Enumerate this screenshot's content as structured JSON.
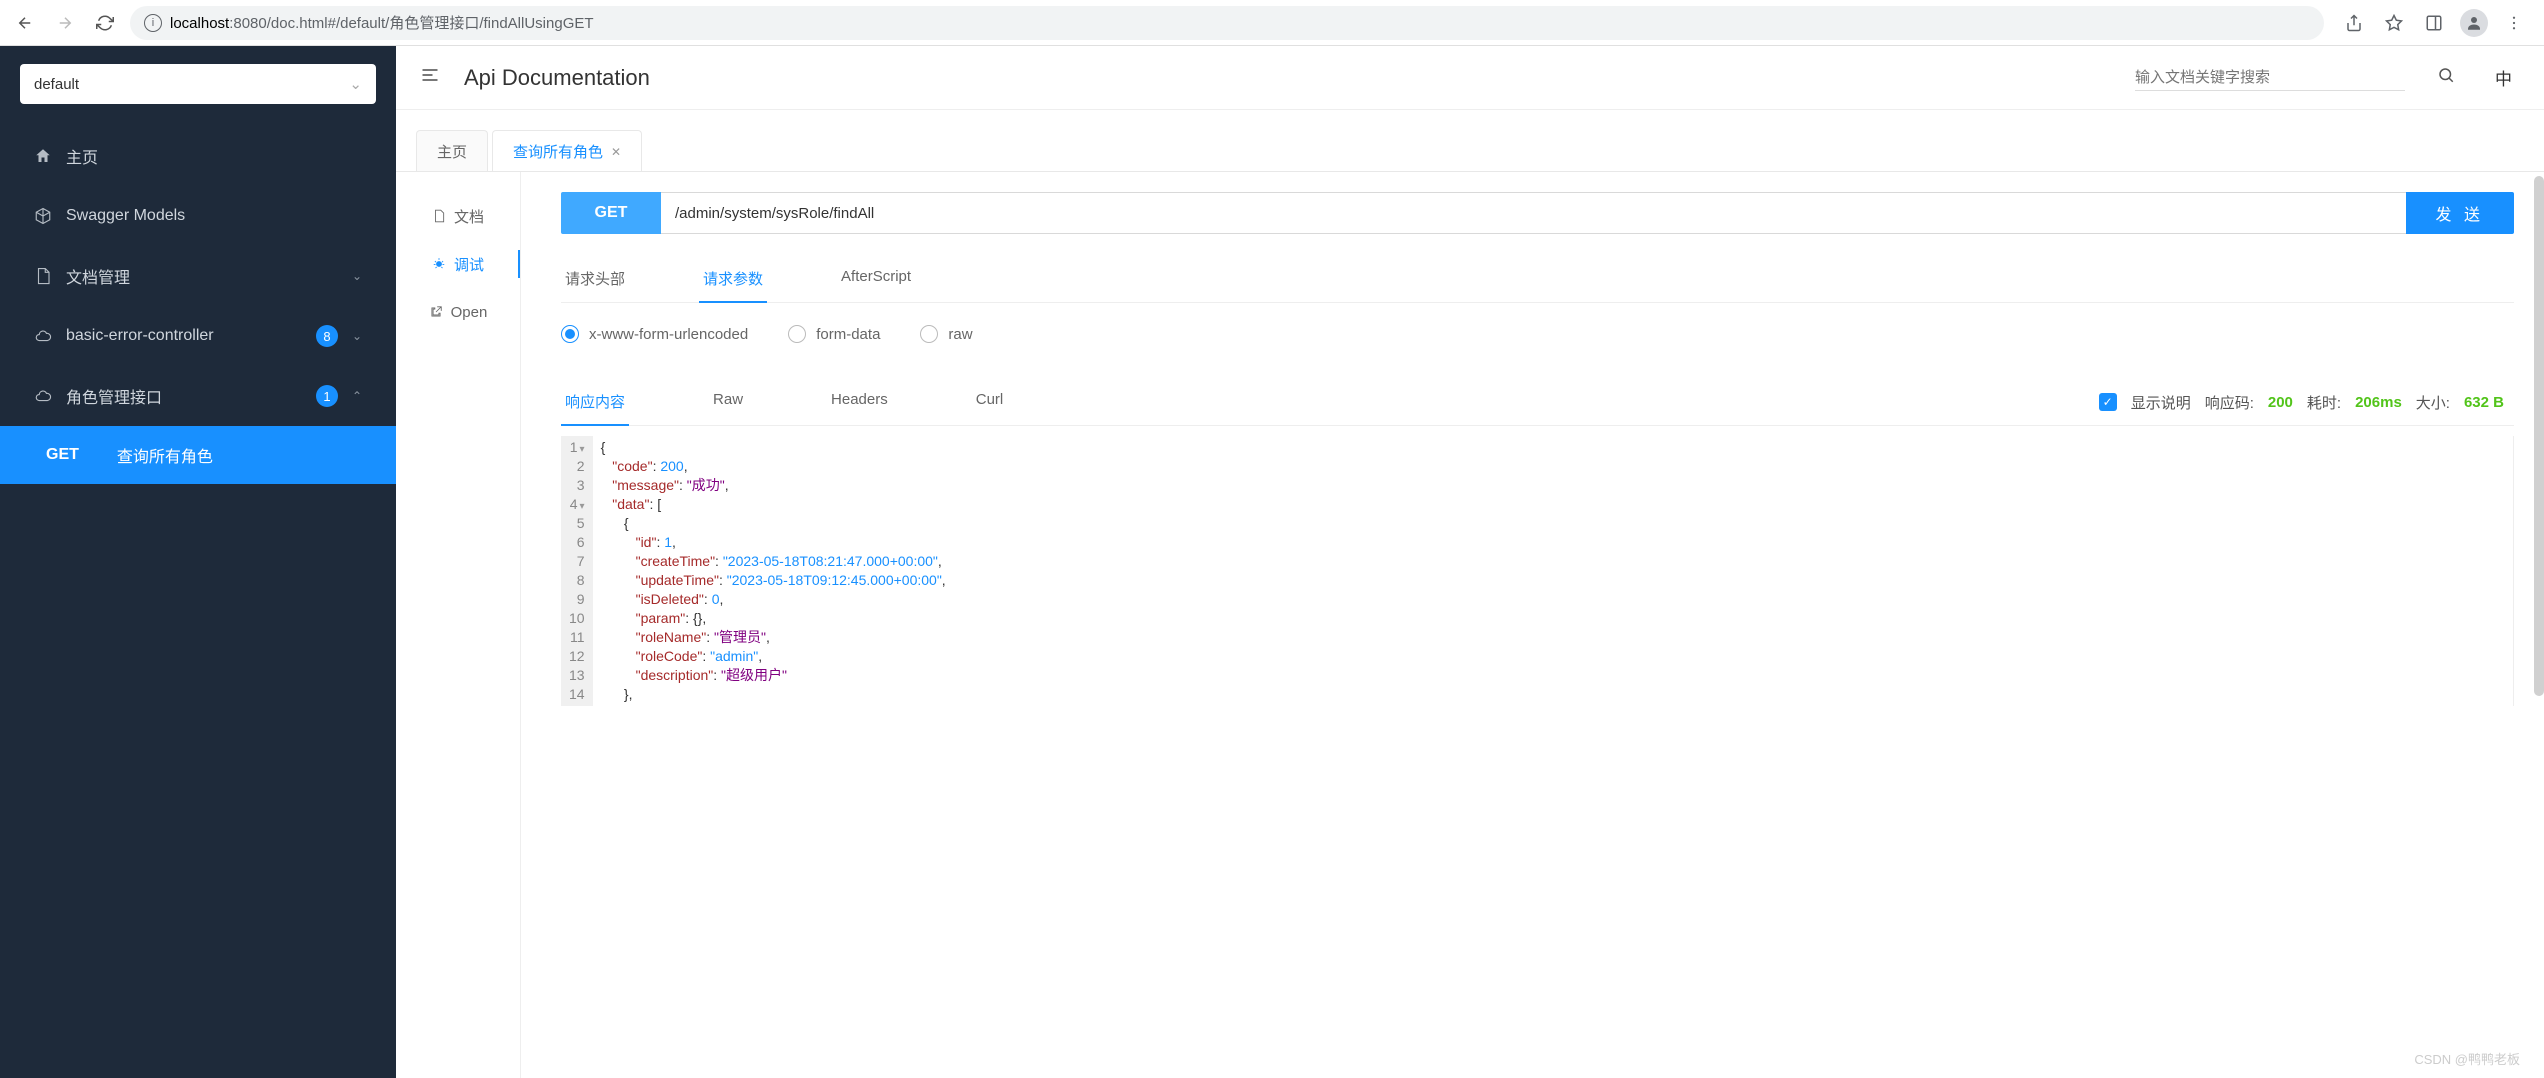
{
  "browser": {
    "url_host": "localhost",
    "url_port": ":8080",
    "url_path": "/doc.html#/default/角色管理接口/findAllUsingGET"
  },
  "sidebar": {
    "select_value": "default",
    "items": [
      {
        "icon": "home",
        "label": "主页"
      },
      {
        "icon": "cube",
        "label": "Swagger Models"
      },
      {
        "icon": "doc",
        "label": "文档管理",
        "chevron": "down"
      },
      {
        "icon": "cloud",
        "label": "basic-error-controller",
        "badge": "8",
        "chevron": "down"
      },
      {
        "icon": "cloud",
        "label": "角色管理接口",
        "badge": "1",
        "chevron": "up"
      }
    ],
    "sub": {
      "method": "GET",
      "label": "查询所有角色"
    }
  },
  "header": {
    "title": "Api Documentation",
    "search_placeholder": "输入文档关键字搜索",
    "lang": "中"
  },
  "tabs": [
    {
      "label": "主页",
      "active": false,
      "closeable": false
    },
    {
      "label": "查询所有角色",
      "active": true,
      "closeable": true
    }
  ],
  "col_tabs": [
    {
      "icon": "file",
      "label": "文档"
    },
    {
      "icon": "bug",
      "label": "调试",
      "active": true
    },
    {
      "icon": "open",
      "label": "Open"
    }
  ],
  "request": {
    "method": "GET",
    "path": "/admin/system/sysRole/findAll",
    "send": "发 送"
  },
  "req_tabs": [
    {
      "label": "请求头部"
    },
    {
      "label": "请求参数",
      "active": true
    },
    {
      "label": "AfterScript"
    }
  ],
  "body_types": [
    {
      "label": "x-www-form-urlencoded",
      "checked": true
    },
    {
      "label": "form-data"
    },
    {
      "label": "raw"
    }
  ],
  "resp_tabs": [
    {
      "label": "响应内容",
      "active": true
    },
    {
      "label": "Raw"
    },
    {
      "label": "Headers"
    },
    {
      "label": "Curl"
    }
  ],
  "resp_meta": {
    "show_desc": "显示说明",
    "code_label": "响应码:",
    "code_val": "200",
    "time_label": "耗时:",
    "time_val": "206ms",
    "size_label": "大小:",
    "size_val": "632 B"
  },
  "response": {
    "code": 200,
    "message": "成功",
    "data_item": {
      "id": 1,
      "createTime": "2023-05-18T08:21:47.000+00:00",
      "updateTime": "2023-05-18T09:12:45.000+00:00",
      "isDeleted": 0,
      "param": "{}",
      "roleName": "管理员",
      "roleCode": "admin",
      "description": "超级用户"
    }
  },
  "watermark": "CSDN @鸭鸭老板"
}
